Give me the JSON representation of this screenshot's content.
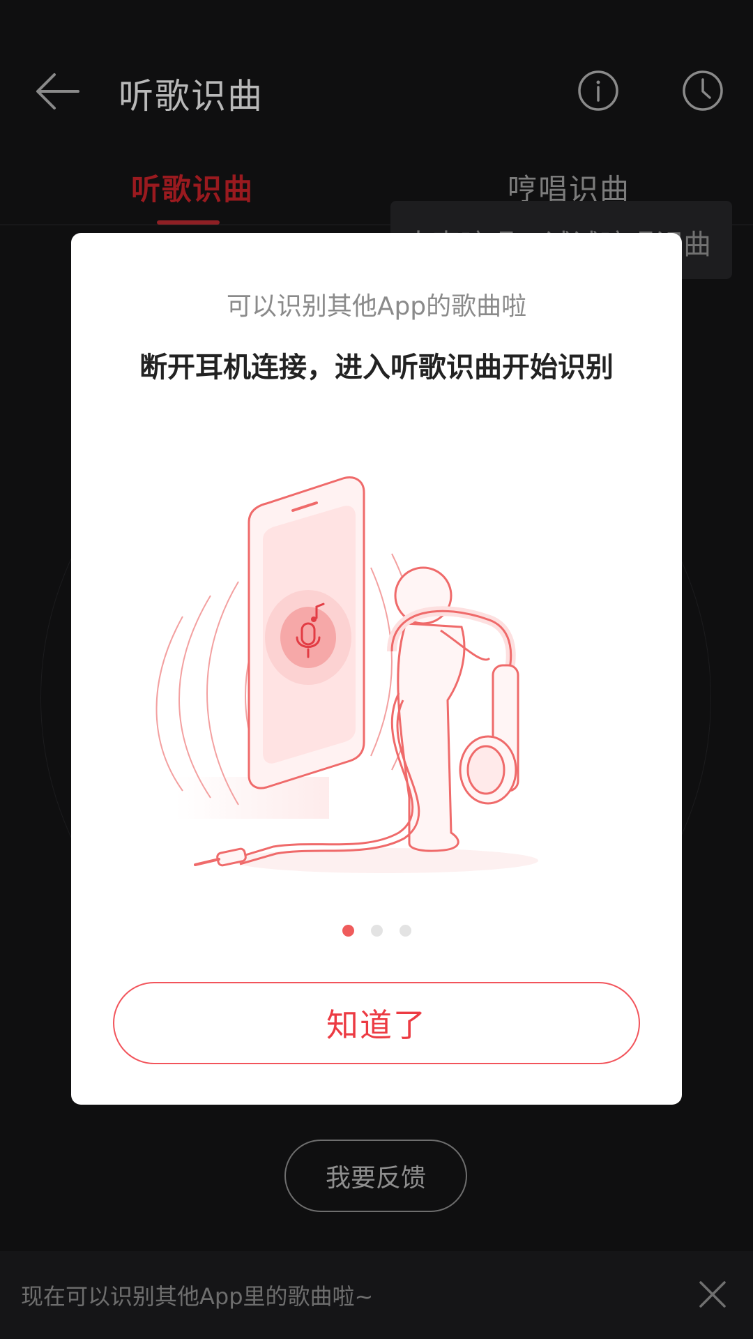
{
  "header": {
    "title": "听歌识曲",
    "back_icon": "arrow-left-icon",
    "info_icon": "info-icon",
    "history_icon": "clock-icon"
  },
  "tabs": [
    {
      "label": "听歌识曲",
      "active": true
    },
    {
      "label": "哼唱识曲",
      "active": false
    }
  ],
  "tooltip": {
    "text": "大声哼唱，试试哼唱识曲"
  },
  "feedback_button": {
    "label": "我要反馈"
  },
  "banner": {
    "text": "现在可以识别其他App里的歌曲啦~",
    "close_icon": "close-icon"
  },
  "dialog": {
    "subtitle": "可以识别其他App的歌曲啦",
    "title": "断开耳机连接，进入听歌识曲开始识别",
    "illustration": "phone-headphones-illustration",
    "page_index": 1,
    "page_count": 3,
    "confirm_label": "知道了"
  },
  "colors": {
    "accent": "#ec3b43",
    "active_tab": "#9a1a1f",
    "overlay_background": "#0f0f10",
    "dialog_background": "#ffffff"
  }
}
